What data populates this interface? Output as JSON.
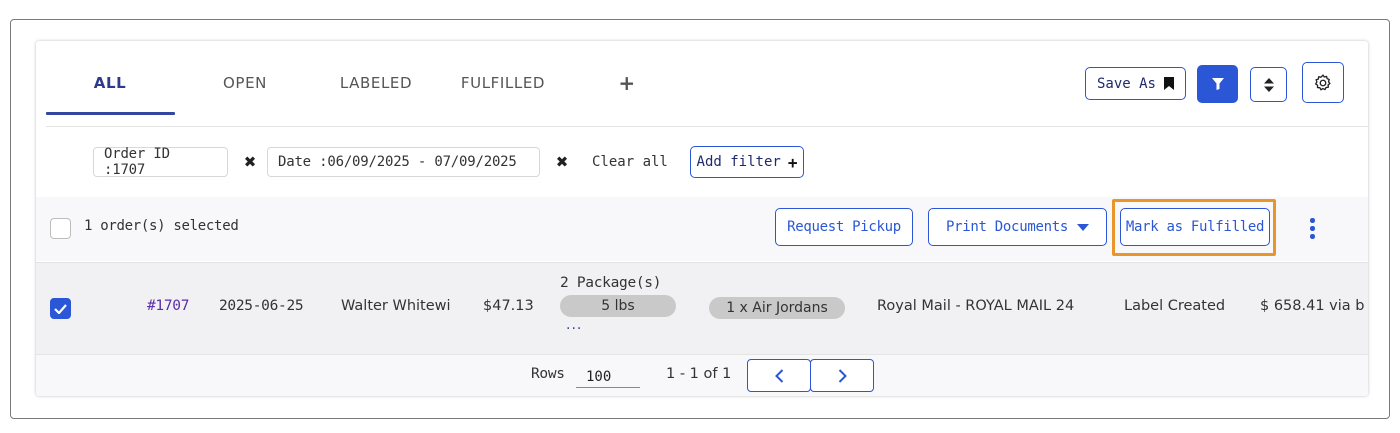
{
  "tabs": [
    {
      "label": "ALL",
      "active": true
    },
    {
      "label": "OPEN",
      "active": false
    },
    {
      "label": "LABELED",
      "active": false
    },
    {
      "label": "FULFILLED",
      "active": false
    }
  ],
  "tab_add_label": "+",
  "toolbar": {
    "save_as_label": "Save As",
    "save_icon": "bookmark-icon",
    "filter_icon": "filter-icon",
    "sort_icon": "sort-icon",
    "settings_icon": "gear-icon"
  },
  "filters": {
    "chips": [
      {
        "label": "Order ID :1707"
      },
      {
        "label": "Date :06/09/2025 - 07/09/2025"
      }
    ],
    "clear_all_label": "Clear all",
    "add_filter_label": "Add filter",
    "add_filter_icon": "plus-icon"
  },
  "selection": {
    "text": "1 order(s) selected",
    "request_pickup_label": "Request Pickup",
    "print_documents_label": "Print Documents",
    "mark_fulfilled_label": "Mark as Fulfilled",
    "more_icon": "kebab-icon"
  },
  "order_row": {
    "checked": true,
    "order_id": "#1707",
    "date": "2025-06-25",
    "customer": "Walter Whitewi",
    "amount": "$47.13",
    "packages_label": "2 Package(s)",
    "weight": "5 lbs",
    "more": "...",
    "items": "1 x Air Jordans",
    "shipping_service": "Royal Mail - ROYAL MAIL 24",
    "status": "Label Created",
    "cost": "$ 658.41 via b"
  },
  "pagination": {
    "rows_label": "Rows",
    "rows_value": "100",
    "range_text": "1 - 1 of 1",
    "prev_icon": "chevron-left-icon",
    "next_icon": "chevron-right-icon"
  },
  "colors": {
    "accent": "#2b56d6",
    "active_tab": "#2e3a8c",
    "highlight": "#e8962c",
    "pill": "#c9c9c9"
  }
}
